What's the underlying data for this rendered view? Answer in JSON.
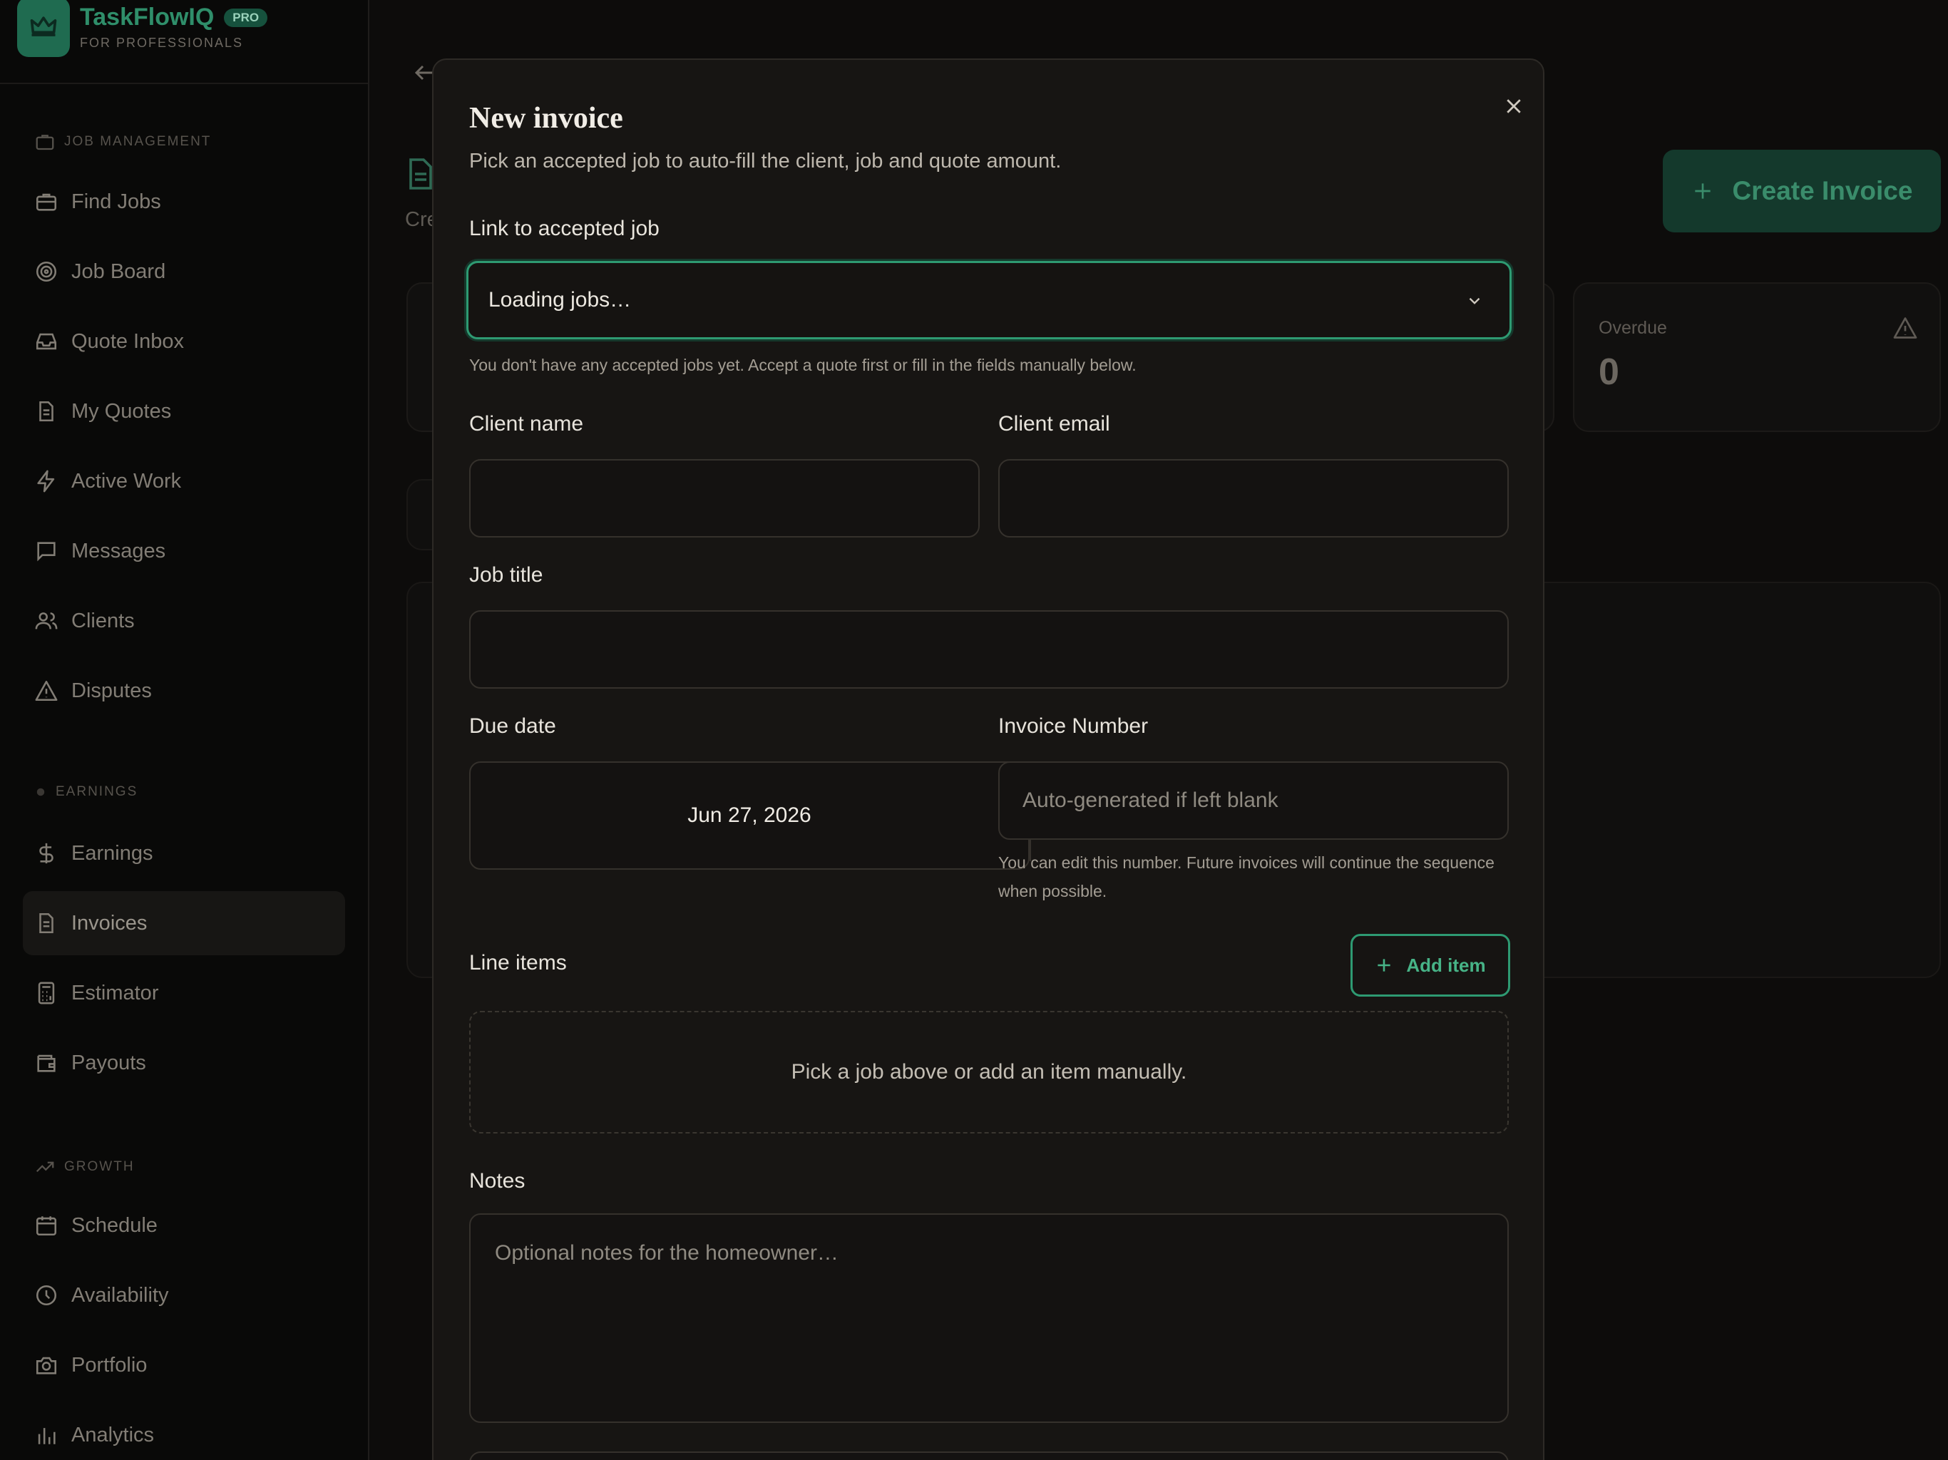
{
  "brand": {
    "name": "TaskFlowIQ",
    "badge": "PRO",
    "subtitle": "FOR PROFESSIONALS"
  },
  "sidebar": {
    "sections": [
      {
        "label": "JOB MANAGEMENT",
        "icon": "briefcase-icon"
      },
      {
        "label": "EARNINGS",
        "icon": "dot-icon"
      },
      {
        "label": "GROWTH",
        "icon": "trending-up-icon"
      }
    ],
    "items": [
      {
        "label": "Find Jobs",
        "icon": "briefcase-icon"
      },
      {
        "label": "Job Board",
        "icon": "target-icon"
      },
      {
        "label": "Quote Inbox",
        "icon": "inbox-icon"
      },
      {
        "label": "My Quotes",
        "icon": "file-text-icon"
      },
      {
        "label": "Active Work",
        "icon": "zap-icon"
      },
      {
        "label": "Messages",
        "icon": "message-square-icon"
      },
      {
        "label": "Clients",
        "icon": "users-icon"
      },
      {
        "label": "Disputes",
        "icon": "alert-triangle-icon"
      },
      {
        "label": "Earnings",
        "icon": "dollar-icon"
      },
      {
        "label": "Invoices",
        "icon": "file-text-icon",
        "active": true
      },
      {
        "label": "Estimator",
        "icon": "calculator-icon"
      },
      {
        "label": "Payouts",
        "icon": "wallet-icon"
      },
      {
        "label": "Schedule",
        "icon": "calendar-icon"
      },
      {
        "label": "Availability",
        "icon": "clock-icon"
      },
      {
        "label": "Portfolio",
        "icon": "camera-icon"
      },
      {
        "label": "Analytics",
        "icon": "bar-chart-icon"
      }
    ]
  },
  "page": {
    "crumb": "Cre",
    "create_button": "Create Invoice",
    "stats": [
      {
        "label": "Overdue",
        "value": "0",
        "icon": "alert-triangle-icon"
      }
    ]
  },
  "modal": {
    "title": "New invoice",
    "subtitle": "Pick an accepted job to auto-fill the client, job and quote amount.",
    "job_link": {
      "label": "Link to accepted job",
      "value": "Loading jobs…",
      "help": "You don't have any accepted jobs yet. Accept a quote first or fill in the fields manually below."
    },
    "client_name": {
      "label": "Client name",
      "value": ""
    },
    "client_email": {
      "label": "Client email",
      "value": ""
    },
    "job_title": {
      "label": "Job title",
      "value": ""
    },
    "due_date": {
      "label": "Due date",
      "value": "Jun 27, 2026"
    },
    "invoice_number": {
      "label": "Invoice Number",
      "placeholder": "Auto-generated if left blank",
      "help": "You can edit this number. Future invoices will continue the sequence when possible."
    },
    "line_items": {
      "label": "Line items",
      "add_label": "Add item",
      "empty": "Pick a job above or add an item manually."
    },
    "notes": {
      "label": "Notes",
      "placeholder": "Optional notes for the homeowner…"
    }
  },
  "colors": {
    "accent": "#2e9a72",
    "modal_bg": "#171513",
    "page_bg": "#0d0c0b"
  }
}
